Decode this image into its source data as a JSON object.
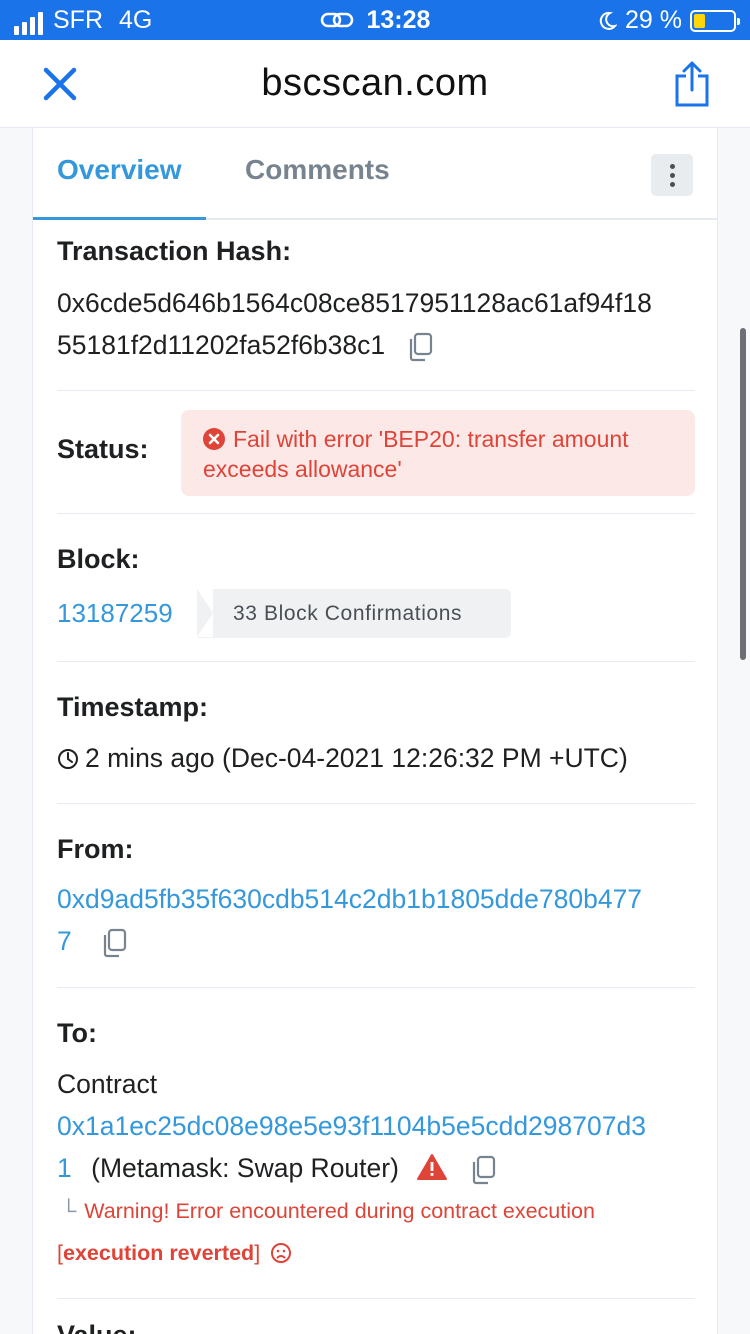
{
  "status_bar": {
    "carrier": "SFR",
    "network": "4G",
    "time": "13:28",
    "battery_text": "29 %",
    "battery_level": 0.29,
    "accent_color": "#1a73e8",
    "icons": [
      "signal-icon",
      "link-icon",
      "moon-icon",
      "battery-icon"
    ]
  },
  "nav": {
    "title": "bscscan.com",
    "close_icon": "close-icon",
    "share_icon": "share-icon"
  },
  "tabs": {
    "overview": "Overview",
    "comments": "Comments"
  },
  "transaction": {
    "hash_label": "Transaction Hash:",
    "hash_line1": "0x6cde5d646b1564c08ce8517951128ac61af94f18",
    "hash_line2": "55181f2d11202fa52f6b38c1",
    "status_label": "Status:",
    "status_line1": "Fail with error 'BEP20: transfer amount",
    "status_line2": "exceeds allowance'",
    "block_label": "Block:",
    "block_number": "13187259",
    "block_confirmations": "33 Block Confirmations",
    "timestamp_label": "Timestamp:",
    "timestamp_value": "2 mins ago (Dec-04-2021 12:26:32 PM +UTC)",
    "from_label": "From:",
    "from_line1": "0xd9ad5fb35f630cdb514c2db1b1805dde780b477",
    "from_line2": "7",
    "to_label": "To:",
    "to_prefix": "Contract",
    "to_line1": "0x1a1ec25dc08e98e5e93f1104b5e5cdd298707d3",
    "to_line2": "1",
    "to_name": "(Metamask: Swap Router)",
    "warning_text": "Warning! Error encountered during contract execution",
    "reverted_text": "execution reverted",
    "value_label": "Value:"
  },
  "colors": {
    "link": "#3498db",
    "error": "#de4437",
    "error_bg": "#fde8e8"
  }
}
